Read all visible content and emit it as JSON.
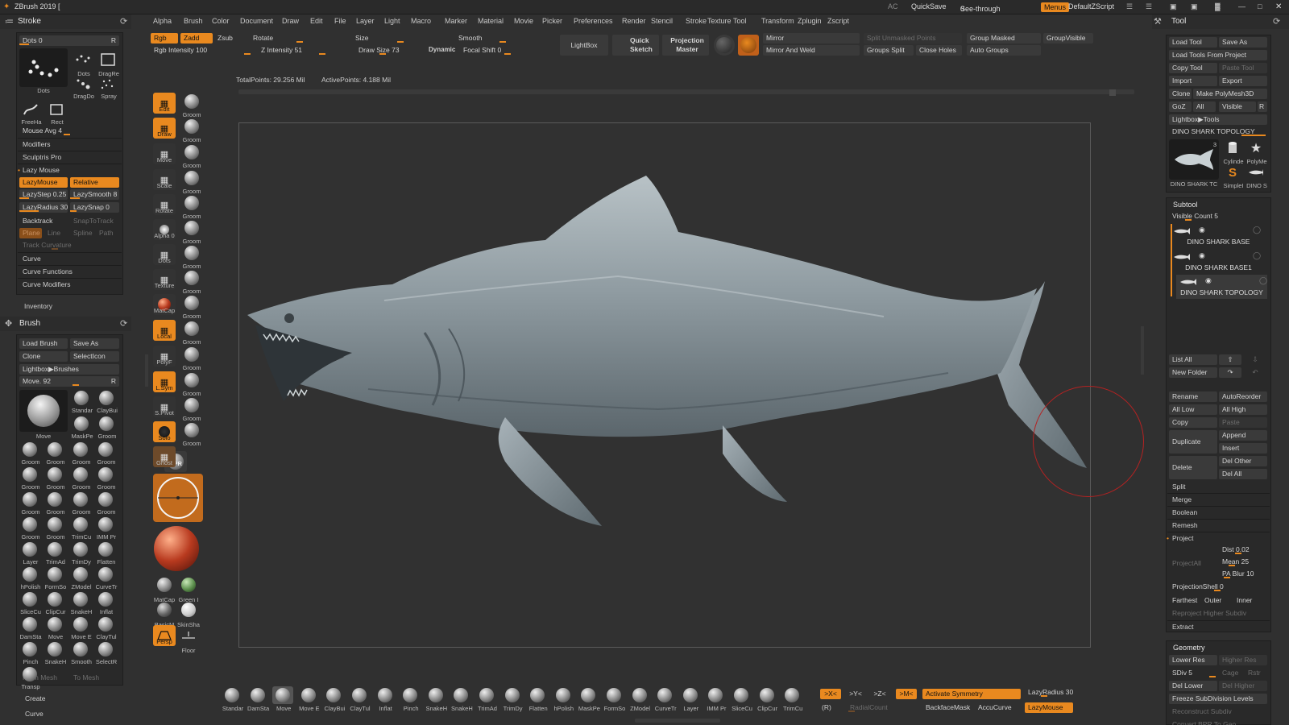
{
  "app": {
    "title": "ZBrush 2019 [",
    "ac": "AC",
    "quicksave": "QuickSave",
    "see_through": "See-through",
    "see_through_value": "0",
    "menus": "Menus",
    "default_script": "DefaultZScript"
  },
  "menubar": [
    "Alpha",
    "Brush",
    "Color",
    "Document",
    "Draw",
    "Edit",
    "File",
    "Layer",
    "Light",
    "Macro",
    "Marker",
    "Material",
    "Movie",
    "Picker",
    "Preferences",
    "Render",
    "Stencil",
    "Stroke",
    "Texture",
    "Tool",
    "Transform",
    "Zplugin",
    "Zscript"
  ],
  "top_controls": {
    "rgb": "Rgb",
    "zadd": "Zadd",
    "zsub": "Zsub",
    "rotate": "Rotate",
    "size": "Size",
    "smooth": "Smooth",
    "rgb_intensity": "Rgb Intensity 100",
    "z_intensity": "Z Intensity 51",
    "draw_size": "Draw Size 73",
    "dynamic": "Dynamic",
    "focal_shift": "Focal Shift 0",
    "lightbox": "LightBox",
    "quick_sketch": "Quick Sketch",
    "projection_master": "Projection Master",
    "mirror": "Mirror",
    "mirror_weld": "Mirror And Weld",
    "split_unmasked": "Split Unmasked Points",
    "groups_split": "Groups Split",
    "close_holes": "Close Holes",
    "group_masked": "Group Masked",
    "auto_groups": "Auto Groups",
    "group_visible": "GroupVisible"
  },
  "stats": {
    "total_points": "TotalPoints: 29.256 Mil",
    "active_points": "ActivePoints: 4.188 Mil"
  },
  "stroke_panel": {
    "title": "Stroke",
    "dots": "Dots 0",
    "r": "R",
    "stroke_types": [
      "Dots",
      "Dots",
      "DragRe",
      "DragDo",
      "Spray",
      "FreeHa",
      "Rect"
    ],
    "mouse_avg": "Mouse Avg 4",
    "modifiers": "Modifiers",
    "sculptris": "Sculptris Pro",
    "lazy_mouse": "Lazy Mouse",
    "lazymouse_btn": "LazyMouse",
    "relative": "Relative",
    "lazystep": "LazyStep 0.25",
    "lazysmooth": "LazySmooth 8",
    "lazyradius": "LazyRadius 30",
    "lazysnap": "LazySnap 0",
    "backtrack": "Backtrack",
    "snaptotrack": "SnapToTrack",
    "plane": "Plane",
    "line": "Line",
    "spline": "Spline",
    "path": "Path",
    "track_curvature": "Track Curvature",
    "curve": "Curve",
    "curve_functions": "Curve Functions",
    "curve_modifiers": "Curve Modifiers",
    "inventory": "Inventory"
  },
  "brush_panel": {
    "title": "Brush",
    "load": "Load Brush",
    "save_as": "Save As",
    "clone": "Clone",
    "selecticon": "SelectIcon",
    "lightbox": "Lightbox▶Brushes",
    "move": "Move. 92",
    "r": "R",
    "current": "Move",
    "brushes": [
      "Standar",
      "ClayBui",
      "MaskPe",
      "Groom",
      "Groom",
      "Groom",
      "Groom",
      "Groom",
      "Groom",
      "Groom",
      "Groom",
      "Groom",
      "Groom",
      "Groom",
      "Groom",
      "Groom",
      "Groom",
      "Groom",
      "TrimCu",
      "IMM Pr",
      "Layer",
      "TrimAd",
      "TrimDy",
      "Flatten",
      "hPolish",
      "FormSo",
      "ZModel",
      "CurveTr",
      "SliceCu",
      "ClipCur",
      "SnakeH",
      "Inflat",
      "DamSta",
      "Move",
      "Move E",
      "ClayTul",
      "Pinch",
      "SnakeH",
      "Smooth",
      "SelectR",
      "Transp"
    ],
    "from_mesh": "From Mesh",
    "to_mesh": "To Mesh",
    "create": "Create",
    "curve": "Curve"
  },
  "left_shelf": [
    {
      "label": "Edit"
    },
    {
      "label": "Draw"
    },
    {
      "label": "Move"
    },
    {
      "label": "Scale"
    },
    {
      "label": "Rotate"
    },
    {
      "label": "Alpha 0"
    },
    {
      "label": "Dots"
    },
    {
      "label": "Texture"
    },
    {
      "label": "MatCap"
    },
    {
      "label": "Local"
    },
    {
      "label": "PolyF"
    },
    {
      "label": "L.Sym"
    },
    {
      "label": "S.Pivot"
    },
    {
      "label": "Solo"
    },
    {
      "label": "Ghost"
    }
  ],
  "groom_column": [
    "Groom",
    "Groom",
    "Groom",
    "Groom",
    "Groom",
    "Groom",
    "Groom",
    "Groom",
    "Groom",
    "Groom",
    "Groom",
    "Groom",
    "Groom",
    "Groom"
  ],
  "bottom_shelf_left": {
    "bpr": "BPR",
    "matcap": "MatCap",
    "green": "Green I",
    "basic": "BasicM",
    "skin": "SkinSha",
    "persp": "Persp",
    "floor": "Floor"
  },
  "bottom_brushes": [
    "Standar",
    "DamSta",
    "Move",
    "Move E",
    "ClayBui",
    "ClayTul",
    "Inflat",
    "Pinch",
    "SnakeH",
    "SnakeH",
    "TrimAd",
    "TrimDy",
    "Flatten",
    "hPolish",
    "MaskPe",
    "FormSo",
    "ZModel",
    "CurveTr",
    "Layer",
    "IMM Pr",
    "SliceCu",
    "ClipCur",
    "TrimCu"
  ],
  "symmetry": {
    "x": ">X<",
    "y": ">Y<",
    "z": ">Z<",
    "m": ">M<",
    "activate": "Activate Symmetry",
    "lazyradius": "LazyRadius 30",
    "r": "(R)",
    "radial": "RadialCount",
    "backface": "BackfaceMask",
    "accucurve": "AccuCurve",
    "lazymouse": "LazyMouse"
  },
  "tool_panel": {
    "title": "Tool",
    "load_tool": "Load Tool",
    "save_as": "Save As",
    "load_from_project": "Load Tools From Project",
    "copy_tool": "Copy Tool",
    "paste_tool": "Paste Tool",
    "import": "Import",
    "export": "Export",
    "clone": "Clone",
    "make_polymesh": "Make PolyMesh3D",
    "goz": "GoZ",
    "all": "All",
    "visible": "Visible",
    "r": "R",
    "lightbox_tools": "Lightbox▶Tools",
    "current_tool": "DINO SHARK TOPOLOGY",
    "tool_count": "3",
    "thumbs": [
      "DINO SHARK TC",
      "Cylinde",
      "PolyMe",
      "SimpleI",
      "DINO S"
    ],
    "subtool": "Subtool",
    "visible_count": "Visible Count 5",
    "subtools": [
      "DINO SHARK BASE",
      "DINO SHARK BASE1",
      "DINO SHARK TOPOLOGY"
    ],
    "list_all": "List All",
    "new_folder": "New Folder",
    "rename": "Rename",
    "autoreorder": "AutoReorder",
    "all_low": "All Low",
    "all_high": "All High",
    "copy": "Copy",
    "paste": "Paste",
    "duplicate": "Duplicate",
    "append": "Append",
    "insert": "Insert",
    "delete": "Delete",
    "del_other": "Del Other",
    "del_all": "Del All",
    "split": "Split",
    "merge": "Merge",
    "boolean": "Boolean",
    "remesh": "Remesh",
    "project": "Project",
    "projectall": "ProjectAll",
    "dist": "Dist 0.02",
    "mean": "Mean 25",
    "pa_blur": "PA Blur 10",
    "projection_shell": "ProjectionShell 0",
    "farthest": "Farthest",
    "outer": "Outer",
    "inner": "Inner",
    "reproject": "Reproject Higher Subdiv",
    "extract": "Extract",
    "geometry": "Geometry",
    "lower_res": "Lower Res",
    "higher_res": "Higher Res",
    "sdiv": "SDiv 5",
    "cage": "Cage",
    "rstr": "Rstr",
    "del_lower": "Del Lower",
    "del_higher": "Del Higher",
    "freeze": "Freeze SubDivision Levels",
    "reconstruct": "Reconstruct Subdiv",
    "convert_bpr": "Convert BPR To Geo"
  },
  "colors": {
    "accent": "#e9891f",
    "panel": "#292929",
    "background": "#303030",
    "model": "#8a98a0"
  }
}
